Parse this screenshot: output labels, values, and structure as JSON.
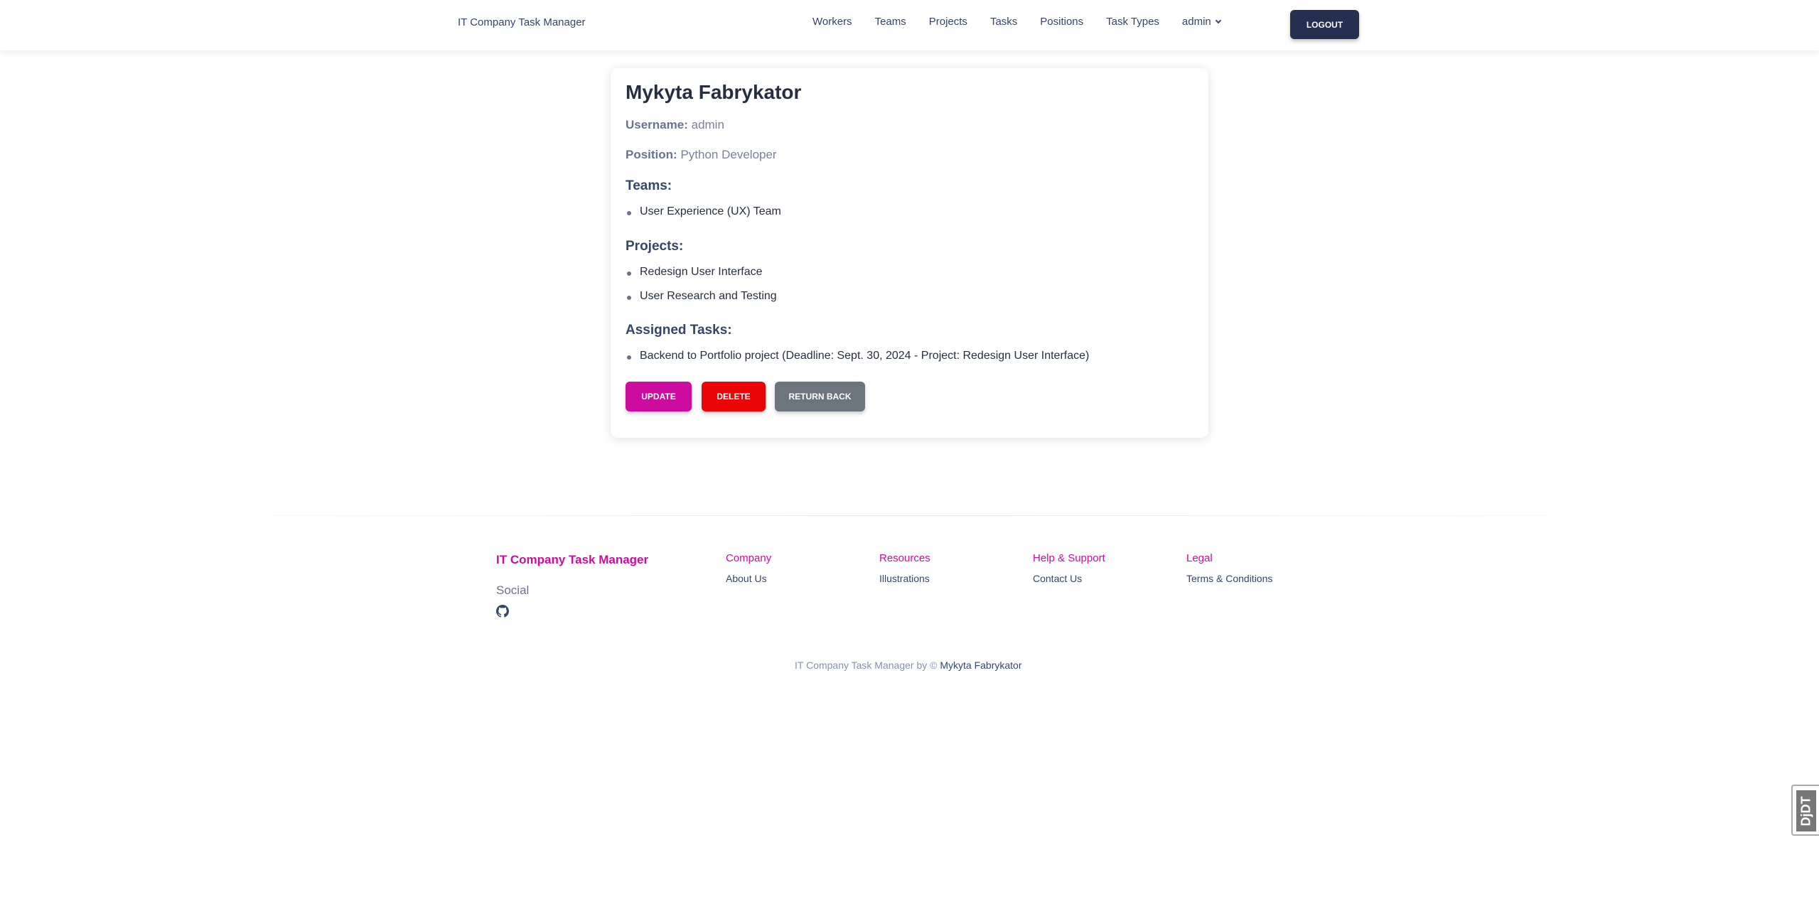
{
  "navbar": {
    "brand": "IT Company Task Manager",
    "links": [
      "Workers",
      "Teams",
      "Projects",
      "Tasks",
      "Positions",
      "Task Types"
    ],
    "user": "admin",
    "logout_label": "LOGOUT"
  },
  "worker": {
    "name": "Mykyta Fabrykator",
    "username_label": "Username:",
    "username": "admin",
    "position_label": "Position:",
    "position": "Python Developer",
    "teams_title": "Teams:",
    "teams": [
      "User Experience (UX) Team"
    ],
    "projects_title": "Projects:",
    "projects": [
      "Redesign User Interface",
      "User Research and Testing"
    ],
    "tasks_title": "Assigned Tasks:",
    "tasks": [
      "Backend to Portfolio project (Deadline: Sept. 30, 2024 - Project: Redesign User Interface)"
    ]
  },
  "actions": {
    "update_label": "UPDATE",
    "delete_label": "DELETE",
    "return_label": "RETURN BACK"
  },
  "footer": {
    "brand": "IT Company Task Manager",
    "social_title": "Social",
    "social_icon": "github-icon",
    "columns": [
      {
        "title": "Company",
        "link": "About Us"
      },
      {
        "title": "Resources",
        "link": "Illustrations"
      },
      {
        "title": "Help & Support",
        "link": "Contact Us"
      },
      {
        "title": "Legal",
        "link": "Terms & Conditions"
      }
    ],
    "copyright_prefix": "IT Company Task Manager by ©",
    "copyright_author": "Mykyta Fabrykator"
  },
  "debug_toolbar": {
    "label": "DjDT"
  },
  "colors": {
    "accent": "#cb0c9f",
    "danger": "#ea0606",
    "secondary": "#6c757d",
    "dark": "#252f50"
  }
}
